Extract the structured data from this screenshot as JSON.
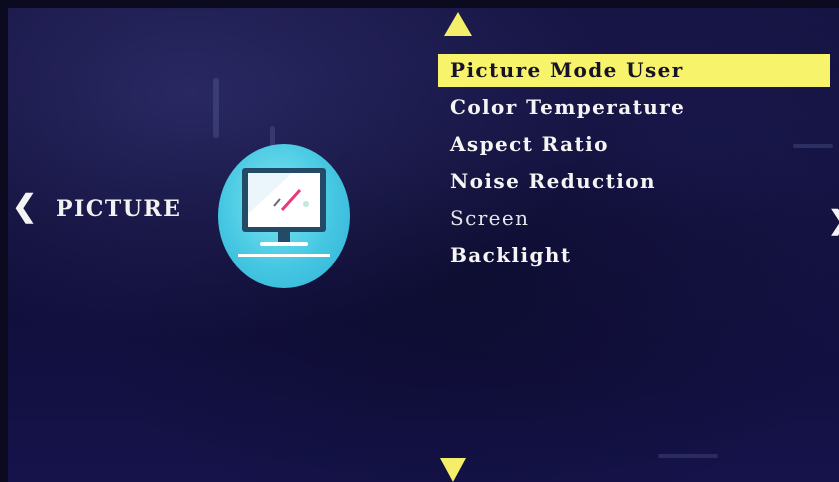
{
  "section": {
    "title": "PICTURE",
    "prev_arrow": "❮",
    "next_arrow": "❯",
    "icon": "tv-monitor-icon"
  },
  "menu": {
    "items": [
      {
        "label": "Picture Mode User",
        "selected": true
      },
      {
        "label": "Color Temperature",
        "selected": false
      },
      {
        "label": "Aspect Ratio",
        "selected": false
      },
      {
        "label": "Noise Reduction",
        "selected": false
      },
      {
        "label": "Screen",
        "selected": false
      },
      {
        "label": "Backlight",
        "selected": false
      }
    ],
    "scroll_up_icon": "triangle-up-icon",
    "scroll_down_icon": "triangle-down-icon"
  },
  "colors": {
    "highlight": "#f7f36a",
    "background": "#14123e",
    "text": "#f5f5f5",
    "icon_circle": "#45c7e2"
  }
}
